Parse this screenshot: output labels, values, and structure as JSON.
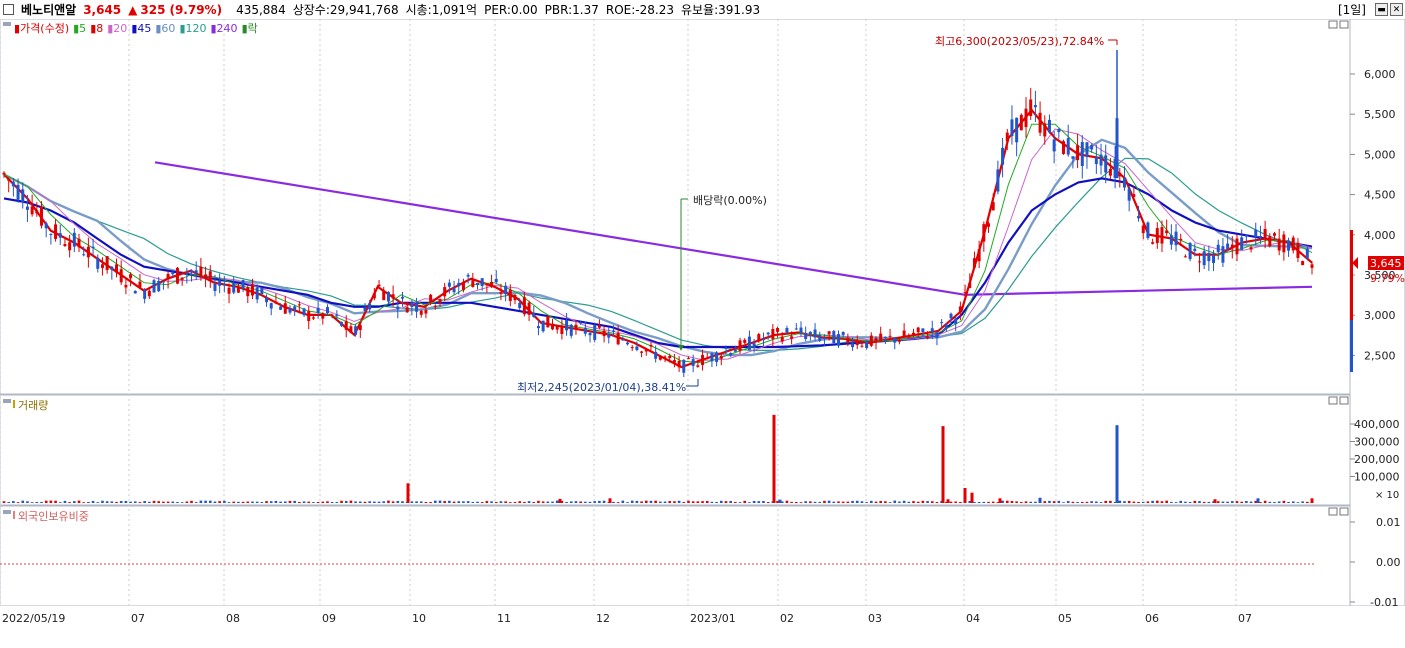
{
  "header": {
    "stock_name": "베노티앤알",
    "price": "3,645",
    "change_arrow": "▲",
    "change": "325",
    "change_pct": "(9.79%)",
    "volume": "435,884",
    "listed": "상장수:29,941,768",
    "mcap": "시총:1,091억",
    "per": "PER:0.00",
    "pbr": "PBR:1.37",
    "roe": "ROE:-28.23",
    "reserve": "유보율:391.93",
    "period": "[1일]"
  },
  "price_panel": {
    "legend": [
      {
        "label": "가격(수정)",
        "color": "#e00000"
      },
      {
        "label": "5",
        "color": "#22aa22"
      },
      {
        "label": "8",
        "color": "#e00000"
      },
      {
        "label": "20",
        "color": "#cc66cc"
      },
      {
        "label": "45",
        "color": "#1010c0"
      },
      {
        "label": "60",
        "color": "#6a8fc0"
      },
      {
        "label": "120",
        "color": "#2a9d8f"
      },
      {
        "label": "240",
        "color": "#8a2be2"
      },
      {
        "label": "락",
        "color": "#2a8a2a"
      }
    ],
    "high_annotation": "최고6,300(2023/05/23),72.84%",
    "low_annotation": "최저2,245(2023/01/04),38.41%",
    "dividend_annotation": "배당락(0.00%)",
    "y_ticks": [
      "6,000",
      "5,500",
      "5,000",
      "4,500",
      "4,000",
      "3,500",
      "3,000",
      "2,500"
    ],
    "current_price_tag": "3,645",
    "current_pct_tag": "9.79%"
  },
  "volume_panel": {
    "legend": "거래량",
    "y_ticks": [
      "400,000",
      "300,000",
      "200,000",
      "100,000"
    ],
    "unit": "× 10"
  },
  "foreign_panel": {
    "legend": "외국인보유비중",
    "y_ticks": [
      "0.01",
      "0.00",
      "-0.01"
    ]
  },
  "x_axis": {
    "labels": [
      "2022/05/19",
      "07",
      "08",
      "09",
      "10",
      "11",
      "12",
      "2023/01",
      "02",
      "03",
      "04",
      "05",
      "06",
      "07"
    ]
  },
  "chart_data": {
    "type": "line",
    "title": "베노티앤알",
    "price_range": [
      2200,
      6400
    ],
    "series": [
      {
        "name": "가격(수정)",
        "values": [
          4750,
          4450,
          4050,
          3900,
          3700,
          3500,
          3300,
          3450,
          3550,
          3400,
          3350,
          3250,
          3100,
          3000,
          3000,
          2750,
          3350,
          3150,
          3100,
          3300,
          3450,
          3350,
          3200,
          2900,
          2850,
          2800,
          2750,
          2650,
          2500,
          2350,
          2450,
          2550,
          2650,
          2750,
          2780,
          2720,
          2700,
          2650,
          2700,
          2750,
          2800,
          3050,
          4050,
          5200,
          5550,
          5200,
          5000,
          4950,
          4700,
          4000,
          3950,
          3750,
          3750,
          3900,
          3950,
          3900,
          3650
        ]
      },
      {
        "name": "45",
        "values": [
          4450,
          4400,
          4300,
          4150,
          3950,
          3750,
          3600,
          3550,
          3500,
          3450,
          3400,
          3350,
          3300,
          3250,
          3150,
          3100,
          3100,
          3150,
          3150,
          3150,
          3150,
          3100,
          3050,
          3000,
          2950,
          2900,
          2850,
          2750,
          2650,
          2600,
          2600,
          2600,
          2600,
          2600,
          2610,
          2620,
          2640,
          2660,
          2680,
          2700,
          2750,
          3000,
          3400,
          3900,
          4300,
          4500,
          4650,
          4700,
          4650,
          4500,
          4300,
          4150,
          4050,
          4000,
          3950,
          3900,
          3850
        ]
      },
      {
        "name": "240",
        "values": [
          4900,
          3250
        ]
      }
    ],
    "volume_peaks": [
      {
        "date": "2022/10/03",
        "value": 105000
      },
      {
        "date": "2023/02/01",
        "value": 470000
      },
      {
        "date": "2023/03/31",
        "value": 410000
      },
      {
        "date": "2023/05/23",
        "value": 415000
      }
    ]
  }
}
